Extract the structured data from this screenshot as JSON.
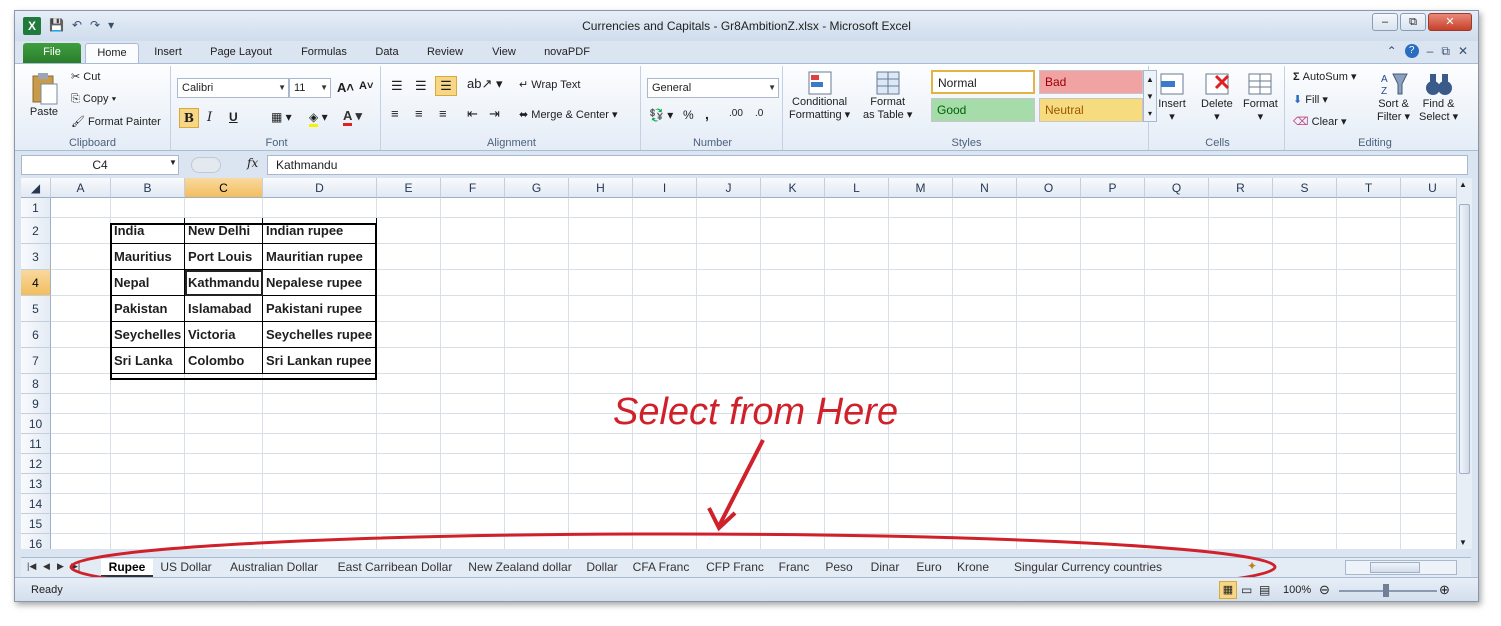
{
  "window": {
    "title": "Currencies and Capitals - Gr8AmbitionZ.xlsx  -  Microsoft Excel",
    "minimize": "–",
    "restore": "⧉",
    "close": "✕"
  },
  "qat": {
    "save": "💾",
    "undo": "↶",
    "redo": "↷",
    "customize": "▾"
  },
  "tabs": [
    "File",
    "Home",
    "Insert",
    "Page Layout",
    "Formulas",
    "Data",
    "Review",
    "View",
    "novaPDF"
  ],
  "ribbon": {
    "clipboard": {
      "label": "Clipboard",
      "paste": "Paste",
      "cut": "Cut",
      "copy": "Copy",
      "format_painter": "Format Painter"
    },
    "font": {
      "label": "Font",
      "name": "Calibri",
      "size": "11",
      "bold": "B",
      "italic": "I",
      "underline": "U",
      "grow": "A˄",
      "shrink": "A˅"
    },
    "alignment": {
      "label": "Alignment",
      "wrap": "Wrap Text",
      "merge": "Merge & Center"
    },
    "number": {
      "label": "Number",
      "format": "General",
      "percent": "%",
      "comma": ",",
      "inc_dec": ".00",
      "dec_dec": ".0"
    },
    "styles": {
      "label": "Styles",
      "cond_format_1": "Conditional",
      "cond_format_2": "Formatting",
      "format_table_1": "Format",
      "format_table_2": "as Table",
      "normal": "Normal",
      "bad": "Bad",
      "good": "Good",
      "neutral": "Neutral"
    },
    "cells": {
      "label": "Cells",
      "insert": "Insert",
      "delete": "Delete",
      "format": "Format"
    },
    "editing": {
      "label": "Editing",
      "autosum": "AutoSum",
      "fill": "Fill",
      "clear": "Clear",
      "sort_1": "Sort &",
      "sort_2": "Filter",
      "find_1": "Find &",
      "find_2": "Select"
    }
  },
  "formula_bar": {
    "name_box": "C4",
    "fx": "fx",
    "value": "Kathmandu"
  },
  "columns": [
    "A",
    "B",
    "C",
    "D",
    "E",
    "F",
    "G",
    "H",
    "I",
    "J",
    "K",
    "L",
    "M",
    "N",
    "O",
    "P",
    "Q",
    "R",
    "S",
    "T",
    "U"
  ],
  "rows": [
    "1",
    "2",
    "3",
    "4",
    "5",
    "6",
    "7",
    "8",
    "9",
    "10",
    "11",
    "12",
    "13",
    "14",
    "15",
    "16"
  ],
  "table": [
    [
      "India",
      "New Delhi",
      "Indian rupee"
    ],
    [
      "Mauritius",
      "Port Louis",
      "Mauritian rupee"
    ],
    [
      "Nepal",
      "Kathmandu",
      "Nepalese rupee"
    ],
    [
      "Pakistan",
      "Islamabad",
      "Pakistani rupee"
    ],
    [
      "Seychelles",
      "Victoria",
      "Seychelles rupee"
    ],
    [
      "Sri Lanka",
      "Colombo",
      "Sri Lankan rupee"
    ]
  ],
  "annotation": {
    "text": "Select from Here",
    "color": "#d0202a"
  },
  "sheets": [
    "Rupee",
    "US Dollar",
    "Australian Dollar",
    "East Carribean Dollar",
    "New Zealand dollar",
    "Dollar",
    "CFA Franc",
    "CFP Franc",
    "Franc",
    "Peso",
    "Dinar",
    "Euro",
    "Krone",
    "Singular Currency countries"
  ],
  "status": {
    "ready": "Ready",
    "zoom": "100%"
  }
}
